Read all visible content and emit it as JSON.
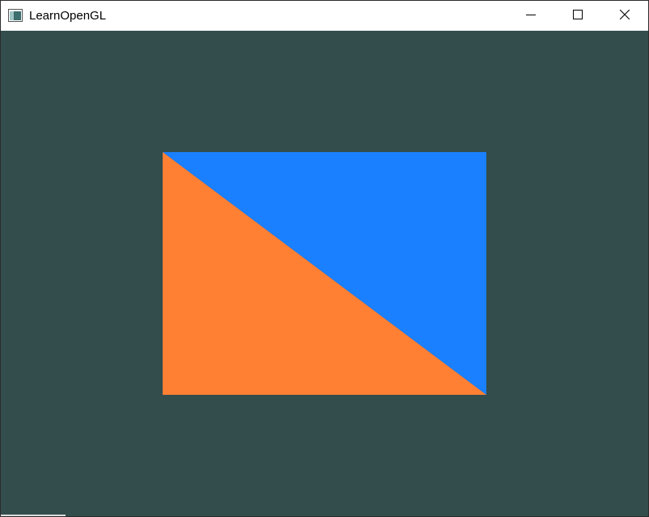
{
  "window": {
    "title": "LearnOpenGL",
    "icons": {
      "app": "opengl-app-icon",
      "minimize": "minimize-icon",
      "maximize": "maximize-icon",
      "close": "close-icon"
    }
  },
  "scene": {
    "clear_color": "#334d4d",
    "shape": "rectangle made of two triangles",
    "upper_right_triangle_color": "#1a80ff",
    "lower_left_triangle_color": "#ff8033"
  }
}
